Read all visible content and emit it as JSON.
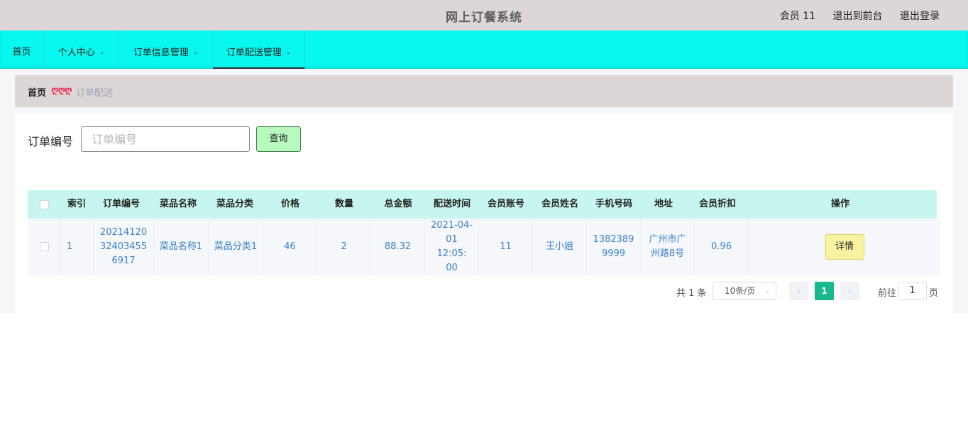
{
  "header": {
    "title": "网上订餐系统",
    "user": "会员 11",
    "back_front": "退出到前台",
    "logout": "退出登录"
  },
  "nav": {
    "home": "首页",
    "personal": "个人中心",
    "order_info": "订单信息管理",
    "order_delivery": "订单配送管理"
  },
  "breadcrumb": {
    "home": "首页",
    "separator": "ღღღ",
    "current": "订单配送"
  },
  "search": {
    "label": "订单编号",
    "placeholder": "订单编号",
    "button": "查询"
  },
  "table": {
    "headers": [
      "索引",
      "订单编号",
      "菜品名称",
      "菜品分类",
      "价格",
      "数量",
      "总金额",
      "配送时间",
      "会员账号",
      "会员姓名",
      "手机号码",
      "地址",
      "会员折扣",
      "操作"
    ],
    "rows": [
      {
        "index": "1",
        "order_no": "20214120 32403455 6917",
        "dish_name": "菜品名称1",
        "dish_category": "菜品分类1",
        "price": "46",
        "quantity": "2",
        "total": "88.32",
        "delivery_time": "2021-04- 01 12:05: 00",
        "member_account": "11",
        "member_name": "王小姐",
        "phone": "1382389 9999",
        "address": "广州市广 州路8号",
        "discount": "0.96",
        "action": "详情"
      }
    ]
  },
  "pagination": {
    "total": "共 1 条",
    "page_size": "10条/页",
    "current_page": "1",
    "goto_label": "前往",
    "goto_value": "1",
    "goto_suffix": "页"
  },
  "colors": {
    "nav_bg": "#08f7ef",
    "header_bg": "#dcd6d6",
    "table_header_bg": "#c7f6f0",
    "search_button_bg": "#b6fbbd",
    "detail_button_bg": "#f7f3a1",
    "page_active": "#19b88f"
  }
}
